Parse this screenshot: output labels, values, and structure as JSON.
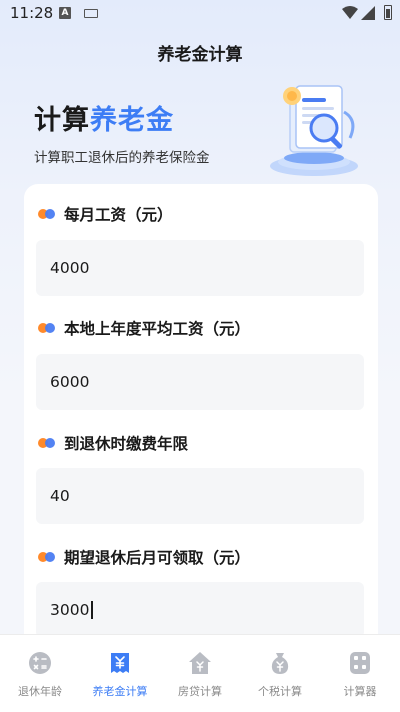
{
  "status_bar": {
    "time": "11:28",
    "notif_letter": "A"
  },
  "nav": {
    "title": "养老金计算"
  },
  "hero": {
    "title_prefix": "计算",
    "title_highlight": "养老金",
    "subtitle": "计算职工退休后的养老保险金"
  },
  "form": {
    "fields": [
      {
        "label": "每月工资（元）",
        "value": "4000"
      },
      {
        "label": "本地上年度平均工资（元）",
        "value": "6000"
      },
      {
        "label": "到退休时缴费年限",
        "value": "40"
      },
      {
        "label": "期望退休后月可领取（元）",
        "value": "3000"
      }
    ]
  },
  "tabs": [
    {
      "label": "退休年龄",
      "icon": "calc-ops-icon",
      "active": false
    },
    {
      "label": "养老金计算",
      "icon": "receipt-yuan-icon",
      "active": true
    },
    {
      "label": "房贷计算",
      "icon": "house-yuan-icon",
      "active": false
    },
    {
      "label": "个税计算",
      "icon": "money-bag-icon",
      "active": false
    },
    {
      "label": "计算器",
      "icon": "calculator-icon",
      "active": false
    }
  ],
  "colors": {
    "accent": "#3d7df5",
    "dot_orange": "#ff8a2b",
    "dot_blue": "#4a7cf2",
    "tab_inactive": "#8a8a8a"
  }
}
